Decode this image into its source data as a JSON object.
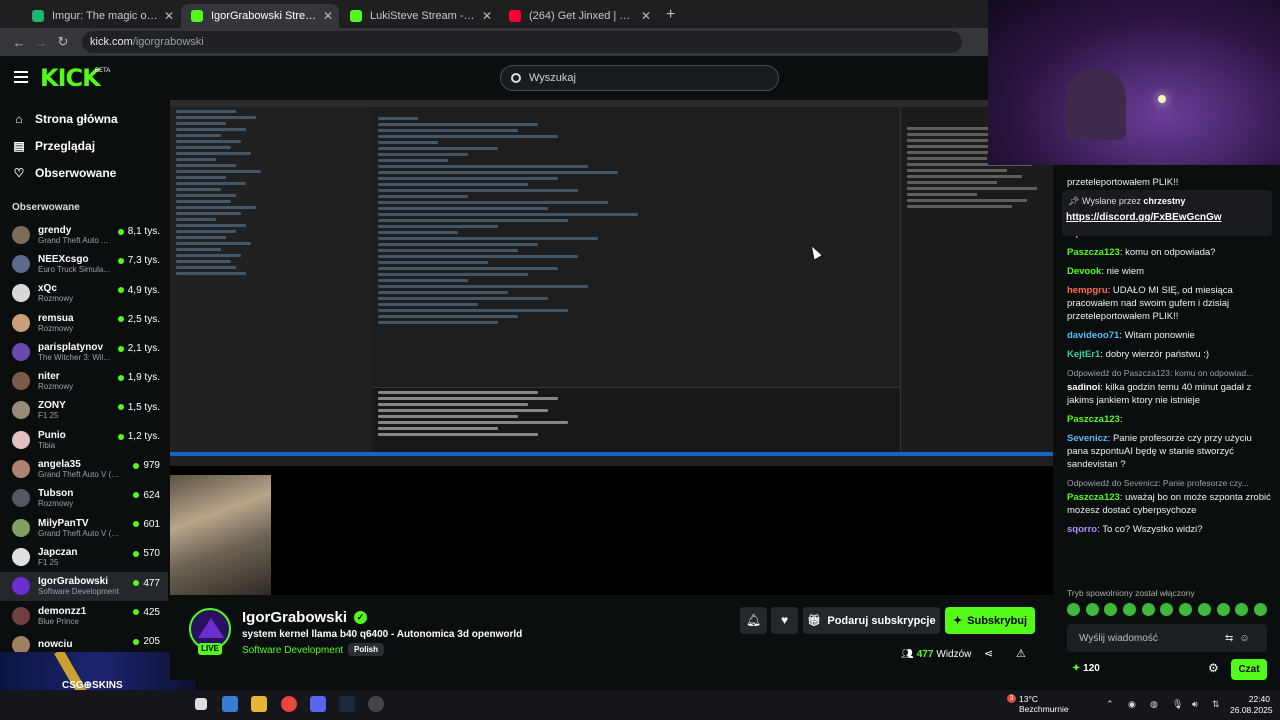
{
  "browser": {
    "tabs": [
      {
        "label": "Imgur: The magic of the Internet",
        "color": "#1bb76e",
        "active": false
      },
      {
        "label": "IgorGrabowski Stream - Watch",
        "color": "#53fc18",
        "active": true
      },
      {
        "label": "LukiSteve Stream - Watch Live",
        "color": "#53fc18",
        "active": false
      },
      {
        "label": "(264) Get Jinxed | League of Legends",
        "color": "#ff0033",
        "active": false
      }
    ],
    "url_host": "kick.com",
    "url_path": "/igorgrabowski"
  },
  "header": {
    "logo": "KICK",
    "beta": "BETA",
    "search_placeholder": "Wyszukaj"
  },
  "sidebar": {
    "nav": [
      {
        "label": "Strona główna",
        "icon": "home-icon"
      },
      {
        "label": "Przeglądaj",
        "icon": "browse-icon"
      },
      {
        "label": "Obserwowane",
        "icon": "heart-icon"
      }
    ],
    "following_title": "Obserwowane",
    "channels": [
      {
        "name": "grendy",
        "category": "Grand Theft Auto ...",
        "viewers": "8,1 tys.",
        "color": "#7d6b5a"
      },
      {
        "name": "NEEXcsgo",
        "category": "Euro Truck Simula...",
        "viewers": "7,3 tys.",
        "color": "#5a6a8a"
      },
      {
        "name": "xQc",
        "category": "Rozmowy",
        "viewers": "4,9 tys.",
        "color": "#d8d8d8"
      },
      {
        "name": "remsua",
        "category": "Rozmowy",
        "viewers": "2,5 tys.",
        "color": "#c9a07a"
      },
      {
        "name": "parisplatynov",
        "category": "The Witcher 3: Wil...",
        "viewers": "2,1 tys.",
        "color": "#6a4ab0"
      },
      {
        "name": "niter",
        "category": "Rozmowy",
        "viewers": "1,9 tys.",
        "color": "#7a5a4a"
      },
      {
        "name": "ZONY",
        "category": "F1 25",
        "viewers": "1,5 tys.",
        "color": "#9a8a7a"
      },
      {
        "name": "Punio",
        "category": "Tibia",
        "viewers": "1,2 tys.",
        "color": "#e0c0c0"
      },
      {
        "name": "angela35",
        "category": "Grand Theft Auto V (G...",
        "viewers": "979",
        "color": "#b08070"
      },
      {
        "name": "Tubson",
        "category": "Rozmowy",
        "viewers": "624",
        "color": "#505860"
      },
      {
        "name": "MilyPanTV",
        "category": "Grand Theft Auto V (G...",
        "viewers": "601",
        "color": "#80a060"
      },
      {
        "name": "Japczan",
        "category": "F1 25",
        "viewers": "570",
        "color": "#e0e0e0"
      },
      {
        "name": "IgorGrabowski",
        "category": "Software Development",
        "viewers": "477",
        "color": "#6a2fd0"
      },
      {
        "name": "demonzz1",
        "category": "Blue Prince",
        "viewers": "425",
        "color": "#704040"
      },
      {
        "name": "nowciu",
        "category": "",
        "viewers": "205",
        "color": "#a08060"
      }
    ]
  },
  "ad": {
    "text": "CSG⊕SKINS"
  },
  "stream": {
    "streamer": "IgorGrabowski",
    "title": "system kernel llama b40 q6400 - Autonomica 3d openworld",
    "category": "Software Development",
    "tag": "Polish",
    "live": "LIVE",
    "gift_label": "Podaruj subskrypcje",
    "sub_label": "Subskrybuj",
    "viewers": "477",
    "viewers_label": "Widzów"
  },
  "chat": {
    "pinned_by_prefix": "Wysłane przez",
    "pinned_by_user": "chrzestny",
    "pinned_link": "https://discord.gg/FxBEwGcnGw",
    "messages": [
      {
        "type": "text",
        "text": "przeteleportowałem PLIK!!"
      },
      {
        "type": "text",
        "text": "pracowałem nad swoim gufem i dzisiaj przeteleportowałem PLIK!!"
      },
      {
        "type": "msg",
        "user": "sqorro",
        "color": "#b48cff",
        "text": ""
      },
      {
        "type": "msg",
        "user": "Paszcza123",
        "color": "#53fc18",
        "text": "komu on odpowiada?"
      },
      {
        "type": "msg",
        "user": "Devook",
        "color": "#53fc18",
        "text": "nie wiem"
      },
      {
        "type": "msg",
        "user": "hempgru",
        "color": "#ff6a4a",
        "text": "UDAŁO MI SIĘ, od miesiąca pracowałem nad swoim gufem i dzisiaj przeteleportowałem PLIK!!"
      },
      {
        "type": "msg",
        "user": "davideoo71",
        "color": "#4fc3f7",
        "text": "Witam ponownie"
      },
      {
        "type": "msg",
        "user": "KejtEr1",
        "color": "#3ccf9f",
        "text": "dobry wierzór państwu :)"
      },
      {
        "type": "reply",
        "text": "Odpowiedź do Paszcza123: komu on odpowiad..."
      },
      {
        "type": "msg",
        "user": "sadinoi",
        "color": "#ffffff",
        "text": "kilka godzin temu 40 minut gadał z jakims jankiem ktory nie istnieje"
      },
      {
        "type": "msg",
        "user": "Paszcza123",
        "color": "#53fc18",
        "text": ""
      },
      {
        "type": "msg",
        "user": "Sevenicz",
        "color": "#64b5f6",
        "text": "Panie profesorze czy przy użyciu pana szpontuAI będę w stanie stworzyć sandevistan ?"
      },
      {
        "type": "reply",
        "text": "Odpowiedź do Sevenicz: Panie profesorze czy..."
      },
      {
        "type": "msg",
        "user": "Paszcza123",
        "color": "#53fc18",
        "text": "uważaj bo on może szponta zrobić możesz dostać cyberpsychoze"
      },
      {
        "type": "msg",
        "user": "sqorro",
        "color": "#b48cff",
        "text": "To co? Wszystko widzi?"
      }
    ],
    "slow_mode": "Tryb spowolniony został włączony",
    "input_placeholder": "Wyślij wiadomość",
    "points": "120",
    "send_label": "Czat"
  },
  "taskbar": {
    "temperature": "13°C",
    "weather": "Bezchmurnie",
    "weather_badge": "3",
    "time": "22:40",
    "date": "26.08.2025"
  }
}
